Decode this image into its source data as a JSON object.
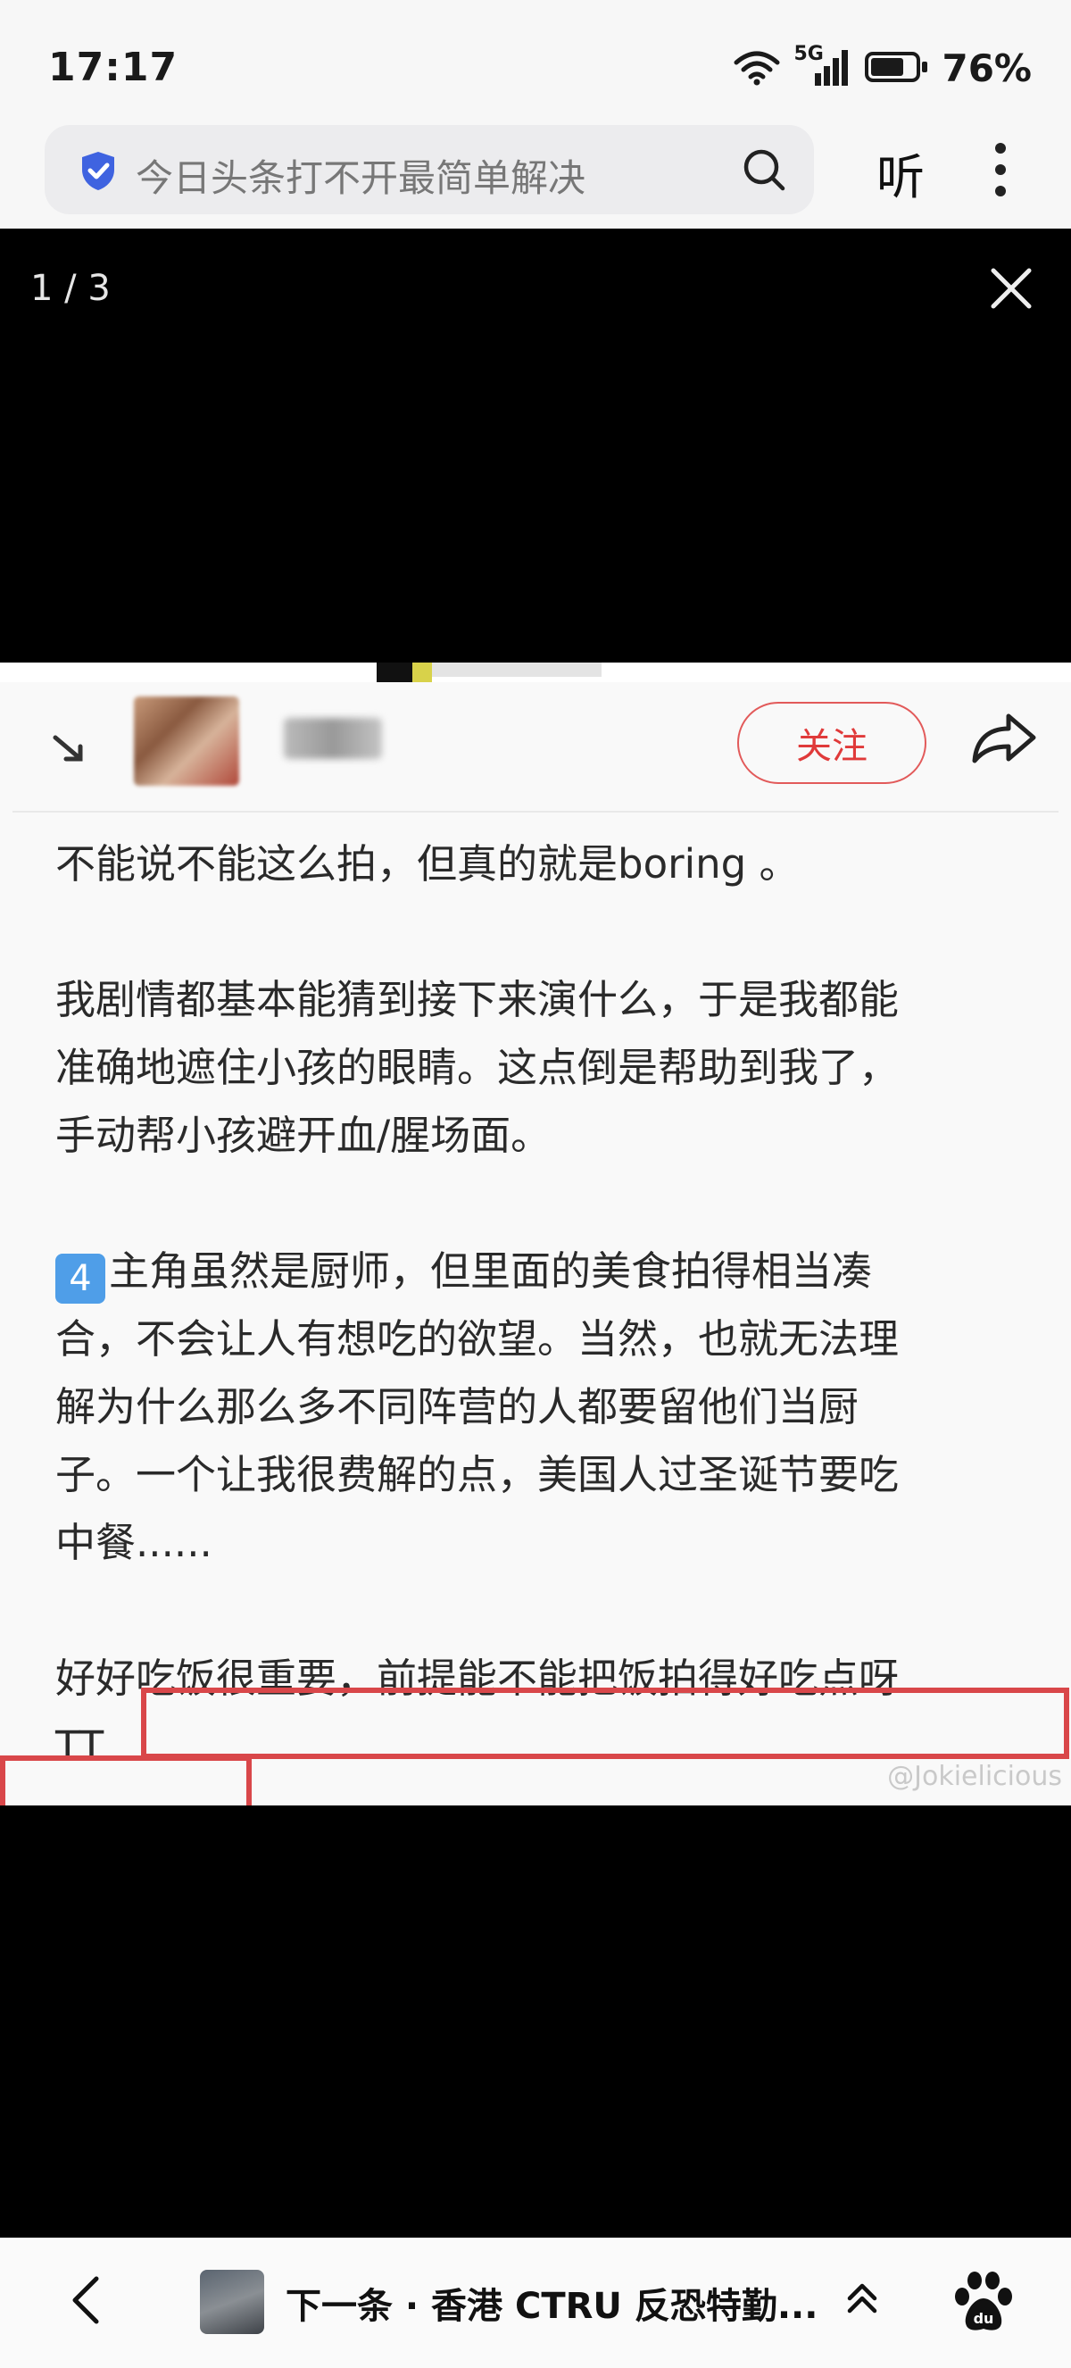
{
  "status_bar": {
    "time": "17:17",
    "network": "5G",
    "battery_percent": "76%",
    "battery_level": 0.76
  },
  "browser": {
    "search_text": "今日头条打不开最简单解决",
    "listen_label": "听",
    "icons": [
      "shield-check-icon",
      "search-icon",
      "more-vertical-icon"
    ]
  },
  "viewer": {
    "counter": "1 / 3",
    "close_icon": "close-icon"
  },
  "post": {
    "follow_label": "关注",
    "share_icon": "share-icon",
    "paragraph1": "不能说不能这么拍，但真的就是boring 。",
    "paragraph2_line1": "我剧情都基本能猜到接下来演什么，于是我都能",
    "paragraph2_line2": "准确地遮住小孩的眼睛。这点倒是帮助到我了，",
    "paragraph2_line3": "手动帮小孩避开血/腥场面。",
    "item_number": "4",
    "paragraph3_line1": "主角虽然是厨师，但里面的美食拍得相当凑",
    "paragraph3_line2": "合，不会让人有想吃的欲望。当然，也就无法理",
    "paragraph3_line3": "解为什么那么多不同阵营的人都要留他们当厨",
    "paragraph3_line4_a": "子。",
    "paragraph3_line4_b": "一个让我很费解的点，美国人过圣诞节要吃",
    "paragraph3_line5": "中餐......",
    "paragraph4_line1": "好好吃饭很重要，前提能不能把饭拍得好吃点呀",
    "paragraph4_line2": "TT",
    "watermark": "@Jokielicious",
    "highlight_color": "#d9474a"
  },
  "bottom_bar": {
    "next_title": "下一条 · 香港 CTRU 反恐特勤...",
    "icons": [
      "back-icon",
      "chevron-up-icon",
      "baidu-paw-icon"
    ]
  }
}
